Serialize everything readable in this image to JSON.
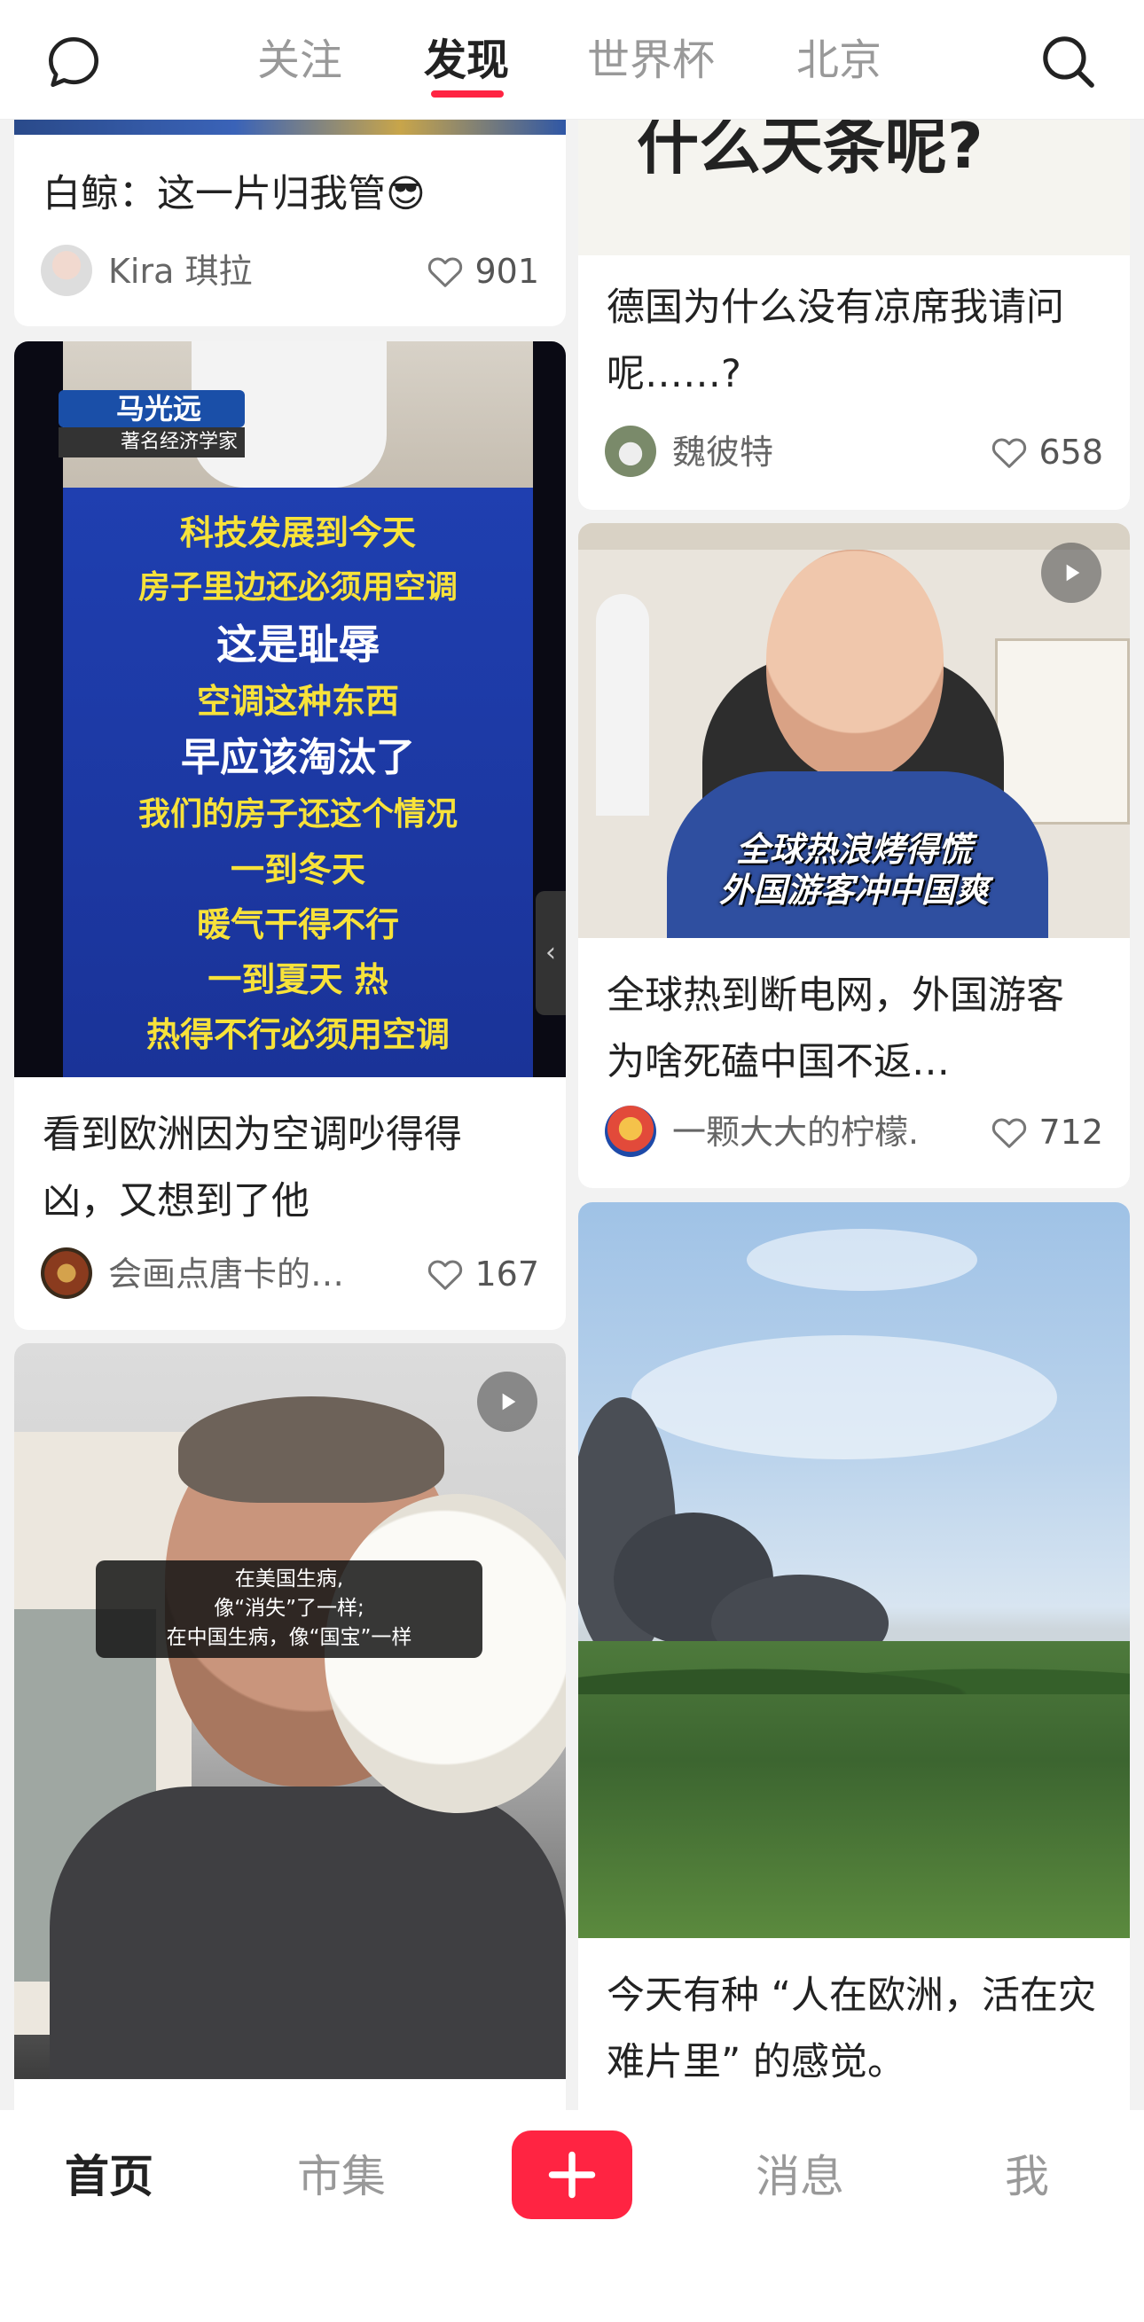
{
  "top_nav": {
    "tabs": [
      {
        "label": "关注"
      },
      {
        "label": "发现"
      },
      {
        "label": "世界杯"
      },
      {
        "label": "北京"
      }
    ],
    "active_tab": "发现",
    "accent_color": "#ff2442"
  },
  "feed": {
    "left": [
      {
        "title": "白鲸：这一片归我管😎",
        "author": "Kira 琪拉",
        "likes": "901"
      },
      {
        "image_text": {
          "name_tag": "马光远",
          "caption_tag": "著名经济学家",
          "lines": [
            "科技发展到今天",
            "房子里边还必须用空调",
            "这是耻辱",
            "空调这种东西",
            "早应该淘汰了",
            "我们的房子还这个情况",
            "一到冬天",
            "暖气干得不行",
            "一到夏天 热",
            "热得不行必须用空调"
          ]
        },
        "title": "看到欧洲因为空调吵得得凶，又想到了他",
        "author": "会画点唐卡的…",
        "likes": "167"
      },
      {
        "image_text": {
          "subtitle_lines": [
            "在美国生病,",
            "像“消失”了一样;",
            "在中国生病，像“国宝”一样"
          ]
        }
      }
    ],
    "right": [
      {
        "image_text": "什么天条呢?",
        "title": "德国为什么没有凉席我请问呢……?",
        "author": "魏彼特",
        "likes": "658"
      },
      {
        "image_text": {
          "overlay_lines": [
            "全球热浪烤得慌",
            "外国游客冲中国爽"
          ]
        },
        "title": "全球热到断电网，外国游客为啥死磕中国不返…",
        "author": "一颗大大的柠檬.",
        "likes": "712"
      },
      {
        "title": "今天有种 “人在欧洲，活在灾难片里” 的感觉。"
      }
    ]
  },
  "bottom_nav": {
    "items": [
      {
        "label": "首页"
      },
      {
        "label": "市集"
      },
      {
        "label": "消息"
      },
      {
        "label": "我"
      }
    ],
    "active_item": "首页",
    "add_color": "#ff2442"
  }
}
